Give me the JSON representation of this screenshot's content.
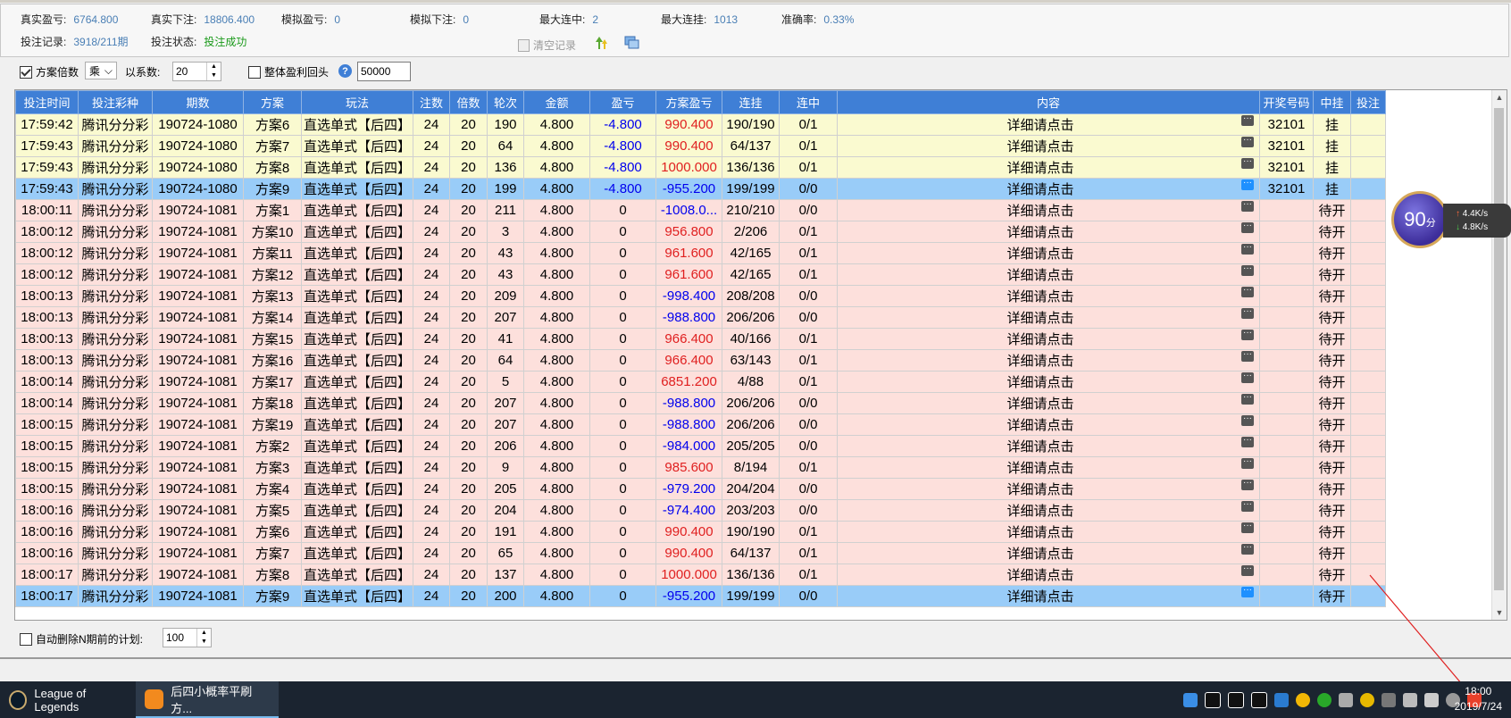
{
  "stats": {
    "real_profit_label": "真实盈亏:",
    "real_profit": "6764.800",
    "real_bet_label": "真实下注:",
    "real_bet": "18806.400",
    "sim_profit_label": "模拟盈亏:",
    "sim_profit": "0",
    "sim_bet_label": "模拟下注:",
    "sim_bet": "0",
    "max_win_label": "最大连中:",
    "max_win": "2",
    "max_lose_label": "最大连挂:",
    "max_lose": "1013",
    "accuracy_label": "准确率:",
    "accuracy": "0.33%",
    "record_label": "投注记录:",
    "record": "3918/211期",
    "status_label": "投注状态:",
    "status": "投注成功",
    "clear_label": "清空记录"
  },
  "options": {
    "multiplier_label": "方案倍数",
    "multiplier_checked": true,
    "op_value": "乘",
    "coef_label": "以系数:",
    "coef_value": "20",
    "rollback_label": "整体盈利回头",
    "rollback_checked": false,
    "help_symbol": "?",
    "rollback_value": "50000"
  },
  "table": {
    "columns": [
      "投注时间",
      "投注彩种",
      "期数",
      "方案",
      "玩法",
      "注数",
      "倍数",
      "轮次",
      "金额",
      "盈亏",
      "方案盈亏",
      "连挂",
      "连中",
      "内容",
      "开奖号码",
      "中挂",
      "投注"
    ],
    "rows": [
      {
        "style": "y",
        "c": [
          "17:59:42",
          "腾讯分分彩",
          "190724-1080",
          "方案6",
          "直选单式【后四】",
          "24",
          "20",
          "190",
          "4.800",
          "-4.800",
          "990.400",
          "190/190",
          "0/1",
          "详细请点击",
          "32101",
          "挂",
          ""
        ],
        "pn": "neg",
        "sp": "pos"
      },
      {
        "style": "y",
        "c": [
          "17:59:43",
          "腾讯分分彩",
          "190724-1080",
          "方案7",
          "直选单式【后四】",
          "24",
          "20",
          "64",
          "4.800",
          "-4.800",
          "990.400",
          "64/137",
          "0/1",
          "详细请点击",
          "32101",
          "挂",
          ""
        ],
        "pn": "neg",
        "sp": "pos"
      },
      {
        "style": "y",
        "c": [
          "17:59:43",
          "腾讯分分彩",
          "190724-1080",
          "方案8",
          "直选单式【后四】",
          "24",
          "20",
          "136",
          "4.800",
          "-4.800",
          "1000.000",
          "136/136",
          "0/1",
          "详细请点击",
          "32101",
          "挂",
          ""
        ],
        "pn": "neg",
        "sp": "pos"
      },
      {
        "style": "s",
        "c": [
          "17:59:43",
          "腾讯分分彩",
          "190724-1080",
          "方案9",
          "直选单式【后四】",
          "24",
          "20",
          "199",
          "4.800",
          "-4.800",
          "-955.200",
          "199/199",
          "0/0",
          "详细请点击",
          "32101",
          "挂",
          ""
        ],
        "pn": "neg",
        "sp": "neg"
      },
      {
        "style": "p",
        "c": [
          "18:00:11",
          "腾讯分分彩",
          "190724-1081",
          "方案1",
          "直选单式【后四】",
          "24",
          "20",
          "211",
          "4.800",
          "0",
          "-1008.0...",
          "210/210",
          "0/0",
          "详细请点击",
          "",
          "待开",
          ""
        ],
        "pn": "",
        "sp": "neg"
      },
      {
        "style": "p",
        "c": [
          "18:00:12",
          "腾讯分分彩",
          "190724-1081",
          "方案10",
          "直选单式【后四】",
          "24",
          "20",
          "3",
          "4.800",
          "0",
          "956.800",
          "2/206",
          "0/1",
          "详细请点击",
          "",
          "待开",
          ""
        ],
        "pn": "",
        "sp": "pos"
      },
      {
        "style": "p",
        "c": [
          "18:00:12",
          "腾讯分分彩",
          "190724-1081",
          "方案11",
          "直选单式【后四】",
          "24",
          "20",
          "43",
          "4.800",
          "0",
          "961.600",
          "42/165",
          "0/1",
          "详细请点击",
          "",
          "待开",
          ""
        ],
        "pn": "",
        "sp": "pos"
      },
      {
        "style": "p",
        "c": [
          "18:00:12",
          "腾讯分分彩",
          "190724-1081",
          "方案12",
          "直选单式【后四】",
          "24",
          "20",
          "43",
          "4.800",
          "0",
          "961.600",
          "42/165",
          "0/1",
          "详细请点击",
          "",
          "待开",
          ""
        ],
        "pn": "",
        "sp": "pos"
      },
      {
        "style": "p",
        "c": [
          "18:00:13",
          "腾讯分分彩",
          "190724-1081",
          "方案13",
          "直选单式【后四】",
          "24",
          "20",
          "209",
          "4.800",
          "0",
          "-998.400",
          "208/208",
          "0/0",
          "详细请点击",
          "",
          "待开",
          ""
        ],
        "pn": "",
        "sp": "neg"
      },
      {
        "style": "p",
        "c": [
          "18:00:13",
          "腾讯分分彩",
          "190724-1081",
          "方案14",
          "直选单式【后四】",
          "24",
          "20",
          "207",
          "4.800",
          "0",
          "-988.800",
          "206/206",
          "0/0",
          "详细请点击",
          "",
          "待开",
          ""
        ],
        "pn": "",
        "sp": "neg"
      },
      {
        "style": "p",
        "c": [
          "18:00:13",
          "腾讯分分彩",
          "190724-1081",
          "方案15",
          "直选单式【后四】",
          "24",
          "20",
          "41",
          "4.800",
          "0",
          "966.400",
          "40/166",
          "0/1",
          "详细请点击",
          "",
          "待开",
          ""
        ],
        "pn": "",
        "sp": "pos"
      },
      {
        "style": "p",
        "c": [
          "18:00:13",
          "腾讯分分彩",
          "190724-1081",
          "方案16",
          "直选单式【后四】",
          "24",
          "20",
          "64",
          "4.800",
          "0",
          "966.400",
          "63/143",
          "0/1",
          "详细请点击",
          "",
          "待开",
          ""
        ],
        "pn": "",
        "sp": "pos"
      },
      {
        "style": "p",
        "c": [
          "18:00:14",
          "腾讯分分彩",
          "190724-1081",
          "方案17",
          "直选单式【后四】",
          "24",
          "20",
          "5",
          "4.800",
          "0",
          "6851.200",
          "4/88",
          "0/1",
          "详细请点击",
          "",
          "待开",
          ""
        ],
        "pn": "",
        "sp": "pos"
      },
      {
        "style": "p",
        "c": [
          "18:00:14",
          "腾讯分分彩",
          "190724-1081",
          "方案18",
          "直选单式【后四】",
          "24",
          "20",
          "207",
          "4.800",
          "0",
          "-988.800",
          "206/206",
          "0/0",
          "详细请点击",
          "",
          "待开",
          ""
        ],
        "pn": "",
        "sp": "neg"
      },
      {
        "style": "p",
        "c": [
          "18:00:15",
          "腾讯分分彩",
          "190724-1081",
          "方案19",
          "直选单式【后四】",
          "24",
          "20",
          "207",
          "4.800",
          "0",
          "-988.800",
          "206/206",
          "0/0",
          "详细请点击",
          "",
          "待开",
          ""
        ],
        "pn": "",
        "sp": "neg"
      },
      {
        "style": "p",
        "c": [
          "18:00:15",
          "腾讯分分彩",
          "190724-1081",
          "方案2",
          "直选单式【后四】",
          "24",
          "20",
          "206",
          "4.800",
          "0",
          "-984.000",
          "205/205",
          "0/0",
          "详细请点击",
          "",
          "待开",
          ""
        ],
        "pn": "",
        "sp": "neg"
      },
      {
        "style": "p",
        "c": [
          "18:00:15",
          "腾讯分分彩",
          "190724-1081",
          "方案3",
          "直选单式【后四】",
          "24",
          "20",
          "9",
          "4.800",
          "0",
          "985.600",
          "8/194",
          "0/1",
          "详细请点击",
          "",
          "待开",
          ""
        ],
        "pn": "",
        "sp": "pos"
      },
      {
        "style": "p",
        "c": [
          "18:00:15",
          "腾讯分分彩",
          "190724-1081",
          "方案4",
          "直选单式【后四】",
          "24",
          "20",
          "205",
          "4.800",
          "0",
          "-979.200",
          "204/204",
          "0/0",
          "详细请点击",
          "",
          "待开",
          ""
        ],
        "pn": "",
        "sp": "neg"
      },
      {
        "style": "p",
        "c": [
          "18:00:16",
          "腾讯分分彩",
          "190724-1081",
          "方案5",
          "直选单式【后四】",
          "24",
          "20",
          "204",
          "4.800",
          "0",
          "-974.400",
          "203/203",
          "0/0",
          "详细请点击",
          "",
          "待开",
          ""
        ],
        "pn": "",
        "sp": "neg"
      },
      {
        "style": "p",
        "c": [
          "18:00:16",
          "腾讯分分彩",
          "190724-1081",
          "方案6",
          "直选单式【后四】",
          "24",
          "20",
          "191",
          "4.800",
          "0",
          "990.400",
          "190/190",
          "0/1",
          "详细请点击",
          "",
          "待开",
          ""
        ],
        "pn": "",
        "sp": "pos"
      },
      {
        "style": "p",
        "c": [
          "18:00:16",
          "腾讯分分彩",
          "190724-1081",
          "方案7",
          "直选单式【后四】",
          "24",
          "20",
          "65",
          "4.800",
          "0",
          "990.400",
          "64/137",
          "0/1",
          "详细请点击",
          "",
          "待开",
          ""
        ],
        "pn": "",
        "sp": "pos"
      },
      {
        "style": "p",
        "c": [
          "18:00:17",
          "腾讯分分彩",
          "190724-1081",
          "方案8",
          "直选单式【后四】",
          "24",
          "20",
          "137",
          "4.800",
          "0",
          "1000.000",
          "136/136",
          "0/1",
          "详细请点击",
          "",
          "待开",
          ""
        ],
        "pn": "",
        "sp": "pos"
      },
      {
        "style": "s",
        "c": [
          "18:00:17",
          "腾讯分分彩",
          "190724-1081",
          "方案9",
          "直选单式【后四】",
          "24",
          "20",
          "200",
          "4.800",
          "0",
          "-955.200",
          "199/199",
          "0/0",
          "详细请点击",
          "",
          "待开",
          ""
        ],
        "pn": "",
        "sp": "neg"
      }
    ]
  },
  "bottom": {
    "auto_delete_label": "自动删除N期前的计划:",
    "auto_delete_checked": false,
    "auto_delete_value": "100"
  },
  "widget": {
    "score": "90",
    "score_unit": "分",
    "up_speed": "4.4K/s",
    "down_speed": "4.8K/s"
  },
  "taskbar": {
    "app1": "League of Legends",
    "app2": "后四小概率平刷方...",
    "time": "18:00",
    "date": "2019/7/24"
  }
}
